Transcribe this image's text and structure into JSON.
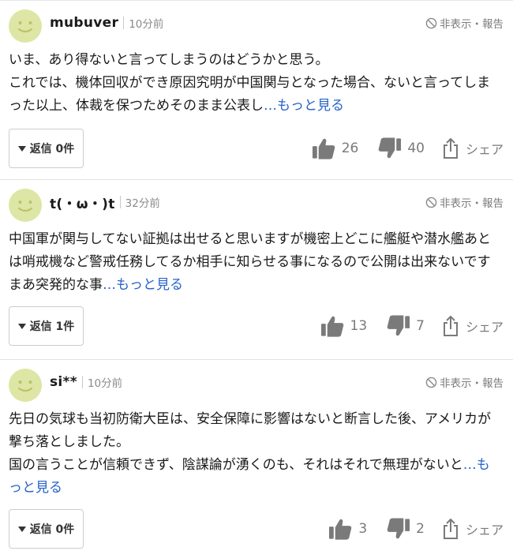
{
  "comments": [
    {
      "username": "mubuver",
      "time": "10分前",
      "hide_report": "非表示・報告",
      "text": "いま、あり得ないと言ってしまうのはどうかと思う。\nこれでは、機体回収ができ原因究明が中国関与となった場合、ないと言ってしまった以上、体裁を保つためそのまま公表し",
      "more": "…もっと見る",
      "reply": "返信 0件",
      "likes": "26",
      "dislikes": "40",
      "share": "シェア"
    },
    {
      "username": "t(・ω・)t",
      "time": "32分前",
      "hide_report": "非表示・報告",
      "text": "中国軍が関与してない証拠は出せると思いますが機密上どこに艦艇や潜水艦あとは哨戒機など警戒任務してるか相手に知らせる事になるので公開は出来ないです　まあ突発的な事",
      "more": "…もっと見る",
      "reply": "返信 1件",
      "likes": "13",
      "dislikes": "7",
      "share": "シェア"
    },
    {
      "username": "si**",
      "time": "10分前",
      "hide_report": "非表示・報告",
      "text": "先日の気球も当初防衛大臣は、安全保障に影響はないと断言した後、アメリカが撃ち落としました。\n国の言うことが信頼できず、陰謀論が湧くのも、それはそれで無理がないと",
      "more": "…もっと見る",
      "reply": "返信 0件",
      "likes": "3",
      "dislikes": "2",
      "share": "シェア"
    }
  ],
  "icons": {
    "avatar": "smiley-avatar-icon",
    "hide": "prohibited-icon",
    "reply": "triangle-down-icon",
    "like": "thumbs-up-icon",
    "dislike": "thumbs-down-icon",
    "share": "share-icon"
  },
  "colors": {
    "avatar_face": "#dde6a4",
    "more_link": "#2563c9",
    "icon_gray": "#7a7a7a"
  }
}
